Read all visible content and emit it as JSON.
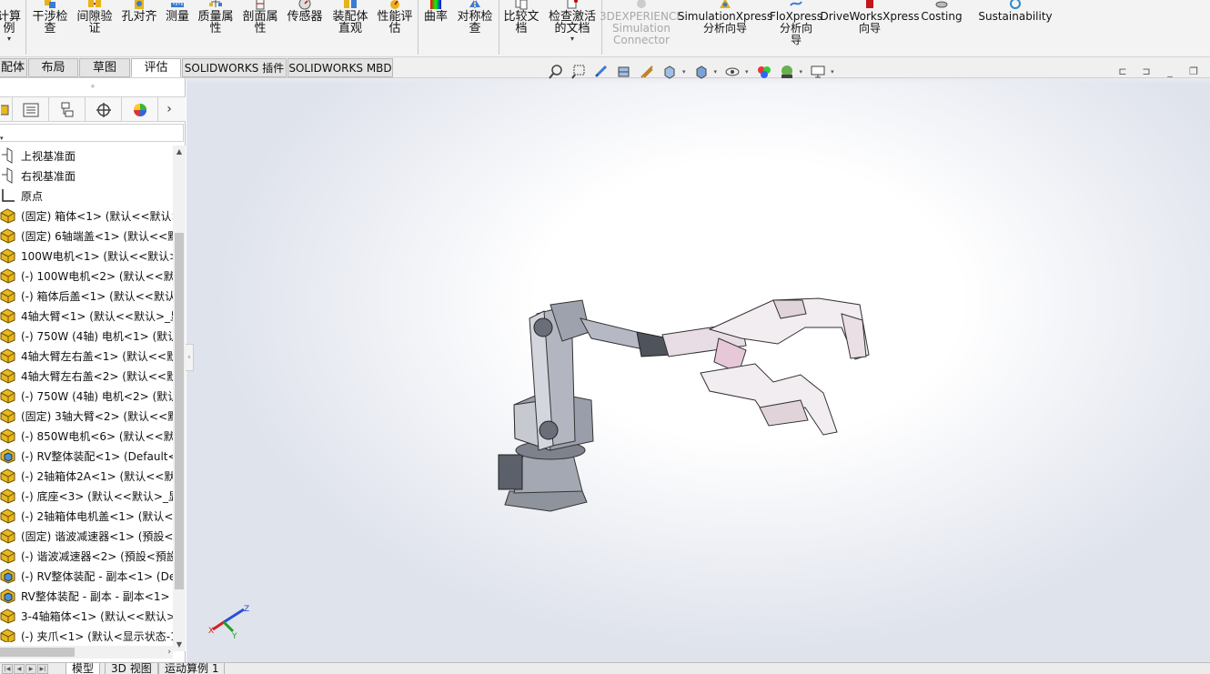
{
  "ribbon": {
    "buttons": [
      {
        "label": "计算\n例",
        "icon": "calculator-icon"
      },
      {
        "label": "干涉检\n查",
        "icon": "interference-check-icon"
      },
      {
        "label": "间隙验\n证",
        "icon": "clearance-verification-icon"
      },
      {
        "label": "孔对齐",
        "icon": "hole-alignment-icon"
      },
      {
        "label": "测量",
        "icon": "measure-icon"
      },
      {
        "label": "质量属\n性",
        "icon": "mass-properties-icon"
      },
      {
        "label": "剖面属\n性",
        "icon": "section-properties-icon"
      },
      {
        "label": "传感器",
        "icon": "sensor-icon"
      },
      {
        "label": "装配体\n直观",
        "icon": "assembly-visualization-icon"
      },
      {
        "label": "性能评\n估",
        "icon": "performance-evaluation-icon"
      },
      {
        "label": "曲率",
        "icon": "curvature-icon"
      },
      {
        "label": "对称检\n查",
        "icon": "symmetry-check-icon"
      },
      {
        "label": "比较文\n档",
        "icon": "compare-documents-icon"
      },
      {
        "label": "检查激活\n的文档",
        "icon": "check-active-document-icon"
      },
      {
        "label": "3DEXPERIENCE\nSimulation\nConnector",
        "icon": "simulation-connector-icon"
      },
      {
        "label": "SimulationXpress\n分析向导",
        "icon": "simulationxpress-icon"
      },
      {
        "label": "FloXpress\n分析向\n导",
        "icon": "floxpress-icon"
      },
      {
        "label": "DriveWorksXpress\n向导",
        "icon": "driveworksxpress-icon"
      },
      {
        "label": "Costing",
        "icon": "costing-icon"
      },
      {
        "label": "Sustainability",
        "icon": "sustainability-icon"
      }
    ]
  },
  "command_tabs": [
    "配体",
    "布局",
    "草图",
    "评估",
    "SOLIDWORKS 插件",
    "SOLIDWORKS MBD"
  ],
  "active_tab": "评估",
  "view_toolbar": [
    "zoom-to-fit-icon",
    "zoom-to-area-icon",
    "previous-view-icon",
    "section-view-icon",
    "dynamic-annotation-icon",
    "view-orientation-icon",
    "display-style-icon",
    "hide-show-items-icon",
    "edit-appearance-icon",
    "apply-scene-icon",
    "view-settings-icon"
  ],
  "panel_tabs": [
    "featuremanager-icon",
    "propertymanager-icon",
    "configurationmanager-icon",
    "dimxpertmanager-icon",
    "displaymanager-icon"
  ],
  "tree": [
    {
      "label": "上视基准面",
      "icon": "plane-icon"
    },
    {
      "label": "右视基准面",
      "icon": "plane-icon"
    },
    {
      "label": "原点",
      "icon": "origin-icon"
    },
    {
      "label": "(固定) 箱体<1> (默认<<默认>",
      "icon": "part-icon"
    },
    {
      "label": "(固定) 6轴端盖<1> (默认<<默",
      "icon": "part-icon"
    },
    {
      "label": "100W电机<1> (默认<<默认>",
      "icon": "part-icon"
    },
    {
      "label": "(-) 100W电机<2> (默认<<默认",
      "icon": "part-icon"
    },
    {
      "label": "(-) 箱体后盖<1> (默认<<默认",
      "icon": "part-icon"
    },
    {
      "label": "4轴大臂<1> (默认<<默认>_显",
      "icon": "part-icon"
    },
    {
      "label": "(-) 750W (4轴) 电机<1> (默认",
      "icon": "part-icon"
    },
    {
      "label": "4轴大臂左右盖<1> (默认<<默",
      "icon": "part-icon"
    },
    {
      "label": "4轴大臂左右盖<2> (默认<<默",
      "icon": "part-icon"
    },
    {
      "label": "(-) 750W (4轴) 电机<2> (默认",
      "icon": "part-icon"
    },
    {
      "label": "(固定) 3轴大臂<2> (默认<<默",
      "icon": "part-icon"
    },
    {
      "label": "(-) 850W电机<6> (默认<<默认",
      "icon": "part-icon"
    },
    {
      "label": "(-) RV整体装配<1> (Default<",
      "icon": "subassembly-icon"
    },
    {
      "label": "(-) 2轴箱体2A<1> (默认<<默认",
      "icon": "part-icon"
    },
    {
      "label": "(-) 底座<3> (默认<<默认>_显",
      "icon": "part-icon"
    },
    {
      "label": "(-) 2轴箱体电机盖<1> (默认<<",
      "icon": "part-icon"
    },
    {
      "label": "(固定) 谐波减速器<1> (預設<預",
      "icon": "part-icon"
    },
    {
      "label": "(-) 谐波减速器<2> (預設<預設",
      "icon": "part-icon"
    },
    {
      "label": "(-) RV整体装配 - 副本<1> (De",
      "icon": "subassembly-icon"
    },
    {
      "label": "RV整体装配 - 副本 - 副本<1>",
      "icon": "subassembly-icon"
    },
    {
      "label": "3-4轴箱体<1> (默认<<默认>_",
      "icon": "part-icon"
    },
    {
      "label": "(-) 夹爪<1> (默认<显示状态-1",
      "icon": "part-icon"
    }
  ],
  "bottom_tabs": [
    "模型",
    "3D 视图",
    "运动算例 1"
  ],
  "active_bottom_tab": "模型",
  "triad": {
    "x": "X",
    "y": "Y",
    "z": "Z"
  },
  "colors": {
    "accent": "#1f6fd1",
    "part_yellow": "#e8b820",
    "viewport_bg": "#e4e7ef"
  }
}
